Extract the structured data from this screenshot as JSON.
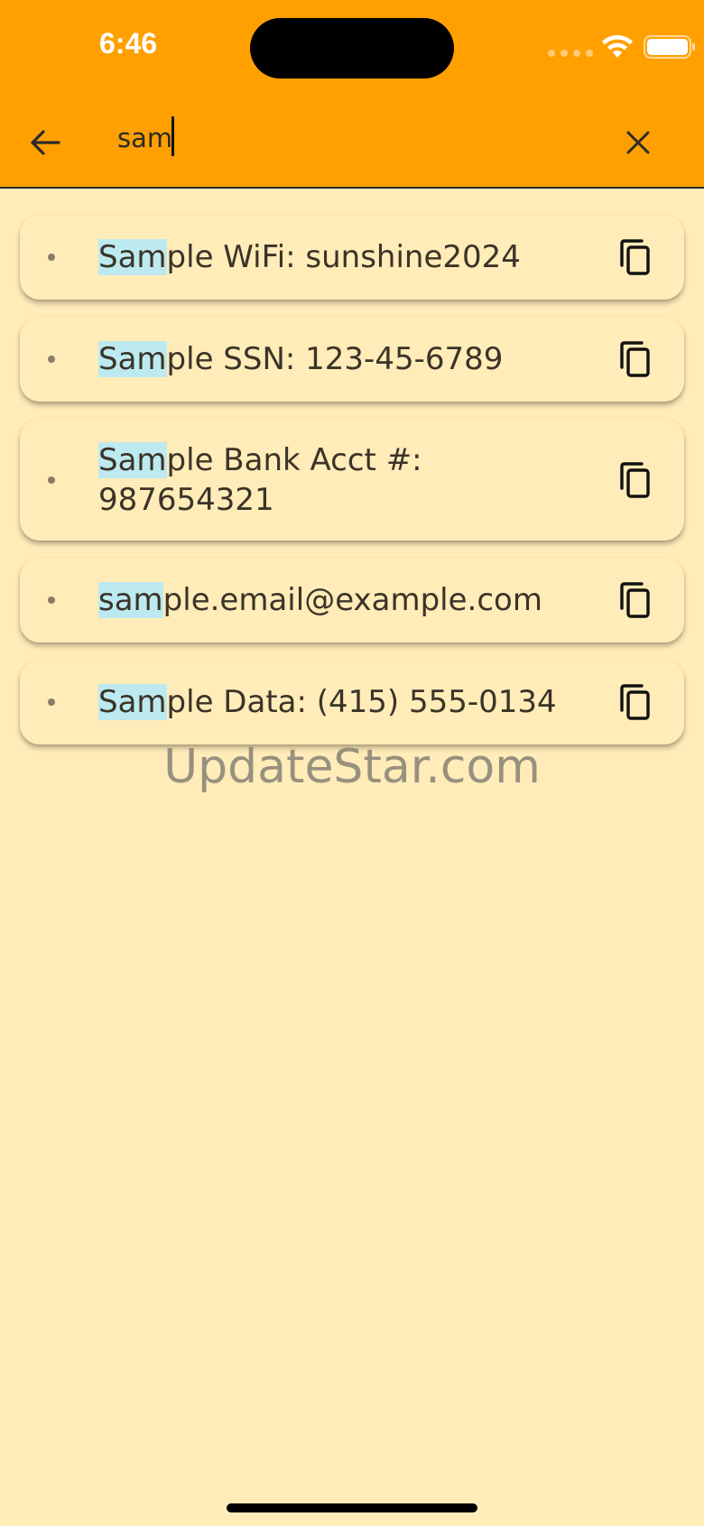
{
  "status_bar": {
    "time": "6:46"
  },
  "search": {
    "query": "sam"
  },
  "icons": {
    "back": "arrow-back-icon",
    "clear": "close-icon",
    "copy": "copy-icon",
    "wifi": "wifi-icon",
    "battery": "battery-icon"
  },
  "results": [
    {
      "match": "Sam",
      "rest": "ple WiFi: sunshine2024"
    },
    {
      "match": "Sam",
      "rest": "ple SSN: 123-45-6789"
    },
    {
      "match": "Sam",
      "rest": "ple Bank Acct #: 987654321"
    },
    {
      "match": "sam",
      "rest": "ple.email@example.com"
    },
    {
      "match": "Sam",
      "rest": "ple Data: (415) 555-0134"
    }
  ],
  "watermark": "UpdateStar.com",
  "colors": {
    "app_bar": "#FFA000",
    "background": "#FFECB8",
    "highlight": "#BDEAF0"
  }
}
